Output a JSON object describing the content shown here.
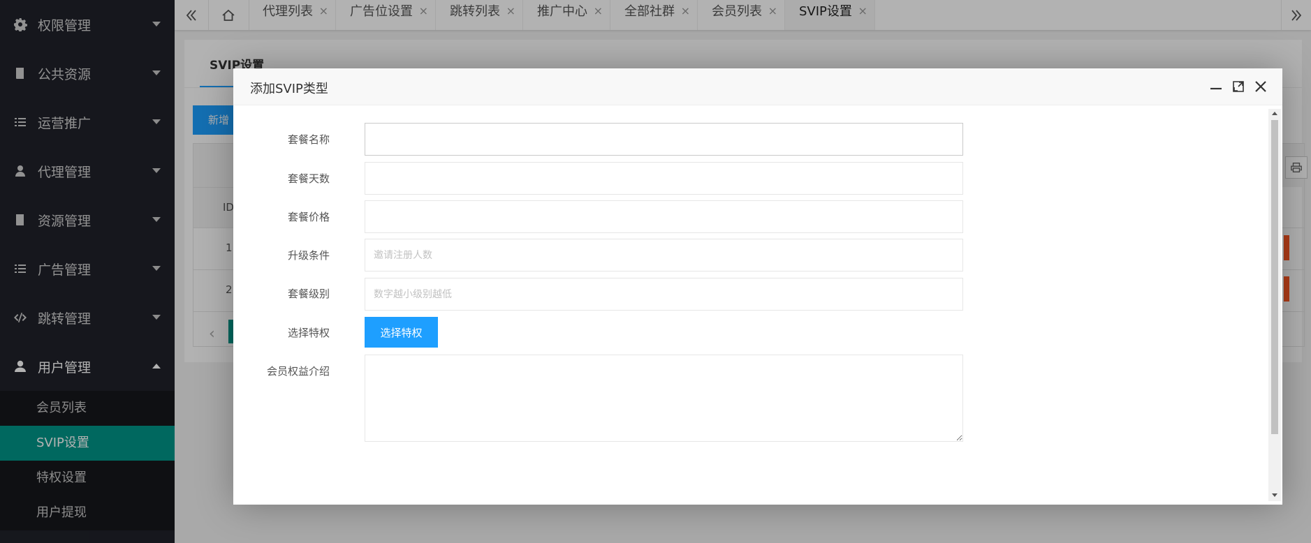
{
  "sidebar": {
    "items": [
      {
        "label": "权限管理",
        "icon": "gear-icon"
      },
      {
        "label": "公共资源",
        "icon": "book-icon"
      },
      {
        "label": "运营推广",
        "icon": "list-icon"
      },
      {
        "label": "代理管理",
        "icon": "user-group-icon"
      },
      {
        "label": "资源管理",
        "icon": "book-icon"
      },
      {
        "label": "广告管理",
        "icon": "list-icon"
      },
      {
        "label": "跳转管理",
        "icon": "code-icon"
      },
      {
        "label": "用户管理",
        "icon": "user-icon"
      }
    ],
    "submenu": [
      {
        "label": "会员列表"
      },
      {
        "label": "SVIP设置",
        "active": true
      },
      {
        "label": "特权设置"
      },
      {
        "label": "用户提现"
      }
    ]
  },
  "tabs": [
    {
      "label": "代理列表"
    },
    {
      "label": "广告位设置"
    },
    {
      "label": "跳转列表"
    },
    {
      "label": "推广中心"
    },
    {
      "label": "全部社群"
    },
    {
      "label": "会员列表"
    },
    {
      "label": "SVIP设置",
      "active": true
    }
  ],
  "tab_close_glyph": "×",
  "page": {
    "title": "SVIP设置",
    "new_button": "新增",
    "id_header": "ID",
    "rows": [
      "1",
      "2"
    ]
  },
  "modal": {
    "title": "添加SVIP类型",
    "fields": {
      "name": {
        "label": "套餐名称",
        "placeholder": ""
      },
      "days": {
        "label": "套餐天数",
        "placeholder": ""
      },
      "price": {
        "label": "套餐价格",
        "placeholder": ""
      },
      "upgrade": {
        "label": "升级条件",
        "placeholder": "邀请注册人数"
      },
      "level": {
        "label": "套餐级别",
        "placeholder": "数字越小级别越低"
      },
      "privilege": {
        "label": "选择特权",
        "button": "选择特权"
      },
      "intro": {
        "label": "会员权益介绍",
        "placeholder": ""
      }
    }
  },
  "colors": {
    "sidebar_bg": "#20222a",
    "active_green": "#009688",
    "primary_blue": "#1E9FFF",
    "danger_orange": "#ff5722"
  }
}
